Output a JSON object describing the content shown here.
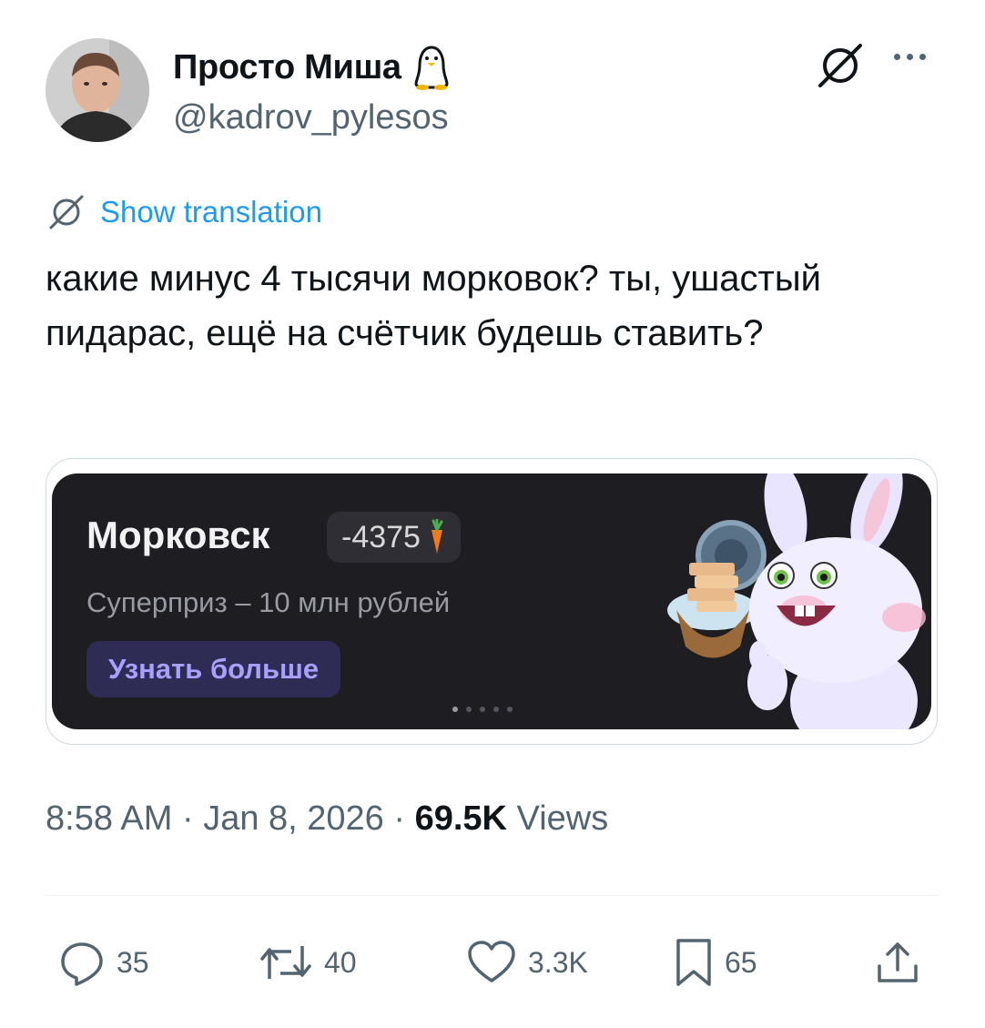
{
  "author": {
    "name": "Просто Миша",
    "handle": "@kadrov_pylesos"
  },
  "translate_label": "Show translation",
  "tweet_text": "какие минус 4 тысячи морковок? ты, ушастый пидарас, ещё на счётчик будешь ставить?",
  "media": {
    "title": "Морковск",
    "balance": "-4375",
    "subtitle": "Суперприз – 10 млн рублей",
    "button_label": "Узнать больше",
    "page_count": 5,
    "active_page": 1
  },
  "meta": {
    "time": "8:58 AM",
    "sep1": " · ",
    "date": "Jan 8, 2026",
    "sep2": " · ",
    "views_count": "69.5K",
    "views_label": " Views"
  },
  "actions": {
    "replies": "35",
    "reposts": "40",
    "likes": "3.3K",
    "bookmarks": "65"
  },
  "icons": [
    "penguin-icon",
    "grok-icon",
    "more-icon",
    "translate-icon",
    "carrot-icon",
    "reply-icon",
    "repost-icon",
    "like-icon",
    "bookmark-icon",
    "share-icon"
  ],
  "colors": {
    "link": "#1d9bf0",
    "secondary_text": "#536471",
    "banner_bg": "#1d1d22",
    "banner_button_text": "#a8a0ff"
  }
}
